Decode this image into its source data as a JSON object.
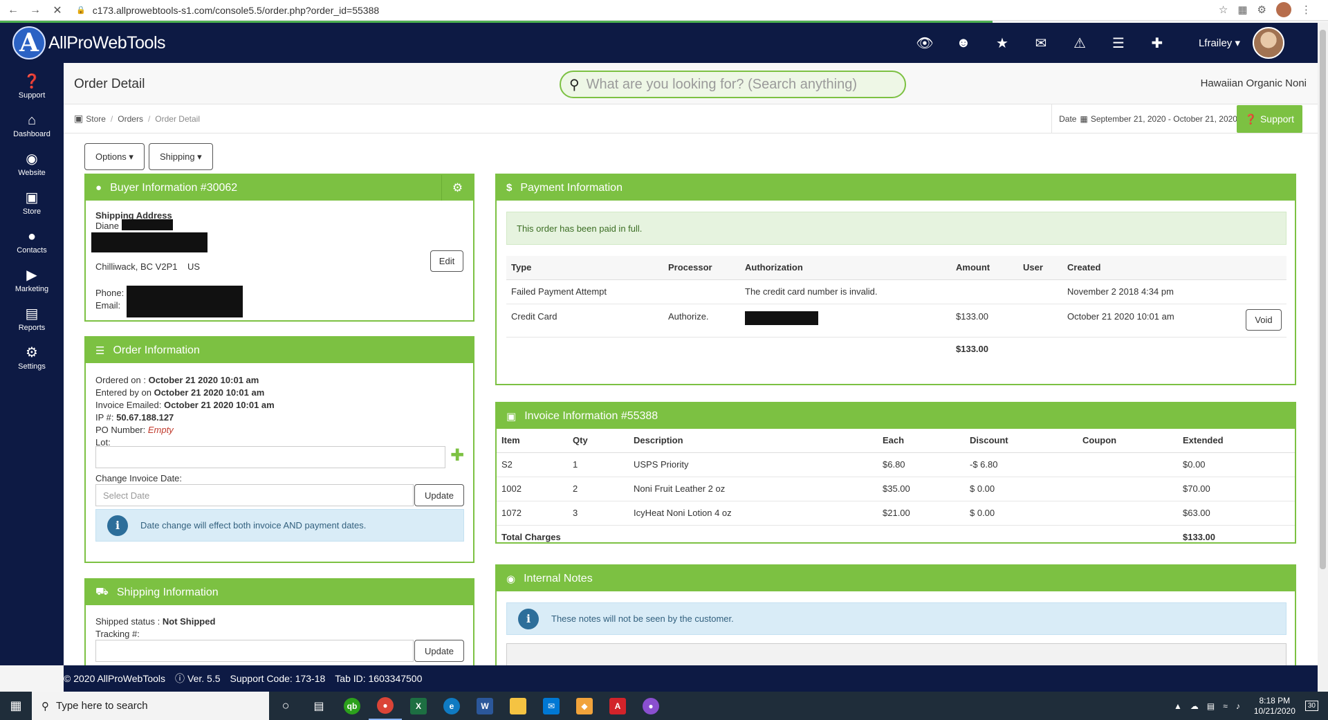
{
  "browser": {
    "url": "c173.allprowebtools-s1.com/console5.5/order.php?order_id=55388"
  },
  "app": {
    "logo_letter": "A",
    "logo_text": "AllProWebTools",
    "user": "Lfrailey",
    "page_title": "Order Detail",
    "search_placeholder": "What are you looking for? (Search anything)",
    "store_name": "Hawaiian Organic Noni"
  },
  "sidebar": {
    "items": [
      {
        "label": "Support",
        "icon": "question-icon"
      },
      {
        "label": "Dashboard",
        "icon": "home-icon"
      },
      {
        "label": "Website",
        "icon": "globe-icon"
      },
      {
        "label": "Store",
        "icon": "cart-icon"
      },
      {
        "label": "Contacts",
        "icon": "user-icon"
      },
      {
        "label": "Marketing",
        "icon": "megaphone-icon"
      },
      {
        "label": "Reports",
        "icon": "folder-icon"
      },
      {
        "label": "Settings",
        "icon": "gear-icon"
      }
    ]
  },
  "breadcrumb": {
    "items": [
      "Store",
      "Orders",
      "Order Detail"
    ]
  },
  "date_filter": {
    "label": "Date",
    "range": "September 21, 2020 - October 21, 2020"
  },
  "support_button": "Support",
  "actions": {
    "options": "Options",
    "shipping": "Shipping"
  },
  "buyer": {
    "title": "Buyer Information #30062",
    "shipping_address_label": "Shipping Address",
    "name": "Diane",
    "city_line": "Chilliwack, BC V2P1",
    "country": "US",
    "phone_label": "Phone:",
    "email_label": "Email:",
    "edit_label": "Edit"
  },
  "order_info": {
    "title": "Order Information",
    "ordered_on_label": "Ordered on :",
    "ordered_on": "October 21 2020 10:01 am",
    "entered_by_label": "Entered by on",
    "entered_by": "October 21 2020 10:01 am",
    "invoice_emailed_label": "Invoice Emailed:",
    "invoice_emailed": "October 21 2020 10:01 am",
    "ip_label": "IP #:",
    "ip": "50.67.188.127",
    "po_label": "PO Number:",
    "po_value": "Empty",
    "lot_label": "Lot:",
    "change_date_label": "Change Invoice Date:",
    "date_placeholder": "Select Date",
    "update_label": "Update",
    "date_note": "Date change will effect both invoice AND payment dates."
  },
  "shipping_info": {
    "title": "Shipping Information",
    "status_label": "Shipped status :",
    "status": "Not Shipped",
    "tracking_label": "Tracking #:",
    "update_label": "Update"
  },
  "payment": {
    "title": "Payment Information",
    "paid_notice": "This order has been paid in full.",
    "columns": [
      "Type",
      "Processor",
      "Authorization",
      "Amount",
      "User",
      "Created"
    ],
    "rows": [
      {
        "type": "Failed Payment Attempt",
        "processor": "",
        "authorization": "The credit card number is invalid.",
        "amount": "",
        "user": "",
        "created": "November 2 2018 4:34 pm"
      },
      {
        "type": "Credit Card",
        "processor": "Authorize.",
        "authorization": "",
        "amount": "$133.00",
        "user": "",
        "created": "October 21 2020 10:01 am"
      }
    ],
    "void_label": "Void",
    "total": "$133.00"
  },
  "invoice": {
    "title": "Invoice Information #55388",
    "columns": [
      "Item",
      "Qty",
      "Description",
      "Each",
      "Discount",
      "Coupon",
      "Extended"
    ],
    "rows": [
      {
        "item": "S2",
        "qty": "1",
        "description": "USPS Priority",
        "each": "$6.80",
        "discount": "-$ 6.80",
        "coupon": "",
        "extended": "$0.00"
      },
      {
        "item": "1002",
        "qty": "2",
        "description": "Noni Fruit Leather 2 oz",
        "each": "$35.00",
        "discount": "$ 0.00",
        "coupon": "",
        "extended": "$70.00"
      },
      {
        "item": "1072",
        "qty": "3",
        "description": "IcyHeat Noni Lotion 4 oz",
        "each": "$21.00",
        "discount": "$ 0.00",
        "coupon": "",
        "extended": "$63.00"
      }
    ],
    "total_label": "Total Charges",
    "total": "$133.00"
  },
  "notes": {
    "title": "Internal Notes",
    "notice": "These notes will not be seen by the customer."
  },
  "footer": {
    "copyright": "© 2020 AllProWebTools",
    "version": "Ver. 5.5",
    "support_code": "Support Code: 173-18",
    "tab_id": "Tab ID: 1603347500"
  },
  "taskbar": {
    "search_placeholder": "Type here to search",
    "time": "8:18 PM",
    "date": "10/21/2020",
    "notifications": "30"
  },
  "colors": {
    "navy": "#0d1a44",
    "green": "#7cc142"
  }
}
